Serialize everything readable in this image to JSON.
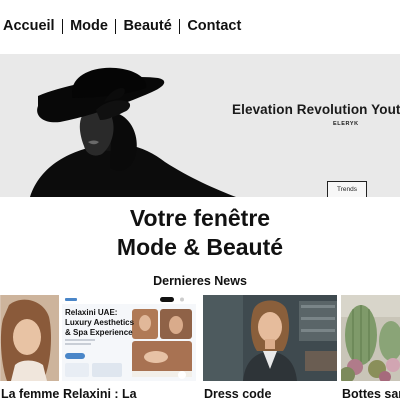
{
  "nav": {
    "items": [
      {
        "label": "Accueil"
      },
      {
        "label": "Mode"
      },
      {
        "label": "Beauté"
      },
      {
        "label": "Contact"
      }
    ]
  },
  "hero": {
    "title": "Elevation Revolution Youth",
    "brand": "ELERYK",
    "button_label": "Trends"
  },
  "main": {
    "title_line1": "Votre fenêtre",
    "title_line2": "Mode & Beauté",
    "news_heading": "Dernieres News"
  },
  "cards": [
    {
      "caption": "La femme :",
      "image": "woman-portrait-image"
    },
    {
      "caption": "Relaxini : La",
      "image": "spa-website-screenshot",
      "thumb": {
        "heading_line1": "Relaxini UAE:",
        "heading_line2": "Luxury Aesthetics",
        "heading_line3": "& Spa Experience"
      }
    },
    {
      "caption": "Dress code",
      "image": "office-woman-image"
    },
    {
      "caption": "Bottes sans",
      "image": "cactus-plants-image"
    }
  ],
  "colors": {
    "text": "#111111",
    "hero_background": "#e9e9e9",
    "spa_accent": "#4a86c8"
  }
}
